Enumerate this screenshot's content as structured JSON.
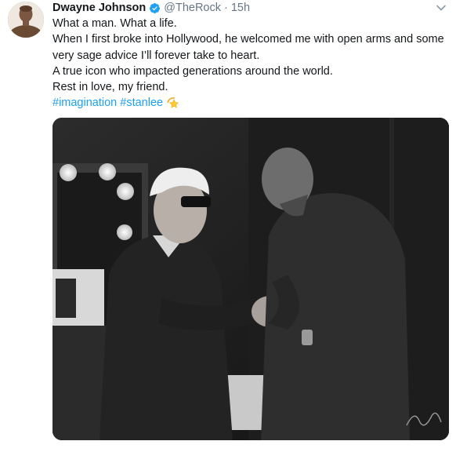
{
  "tweet": {
    "author_name": "Dwayne Johnson",
    "handle": "@TheRock",
    "separator": "·",
    "time": "15h",
    "lines": [
      "What a man. What a life.",
      "When I first broke into Hollywood, he welcomed me with open arms and some very sage advice I’ll forever take to heart.",
      "A true icon who impacted generations around the world.",
      "Rest in love, my friend."
    ],
    "hashtags": [
      "#imagination",
      "#stanlee"
    ],
    "icons": {
      "verified": "verified-badge-icon",
      "menu": "chevron-down-icon",
      "emoji": "dizzy-star-emoji-icon"
    },
    "colors": {
      "link": "#1da1f2",
      "secondary_text": "#657786",
      "primary_text": "#14171a"
    }
  }
}
